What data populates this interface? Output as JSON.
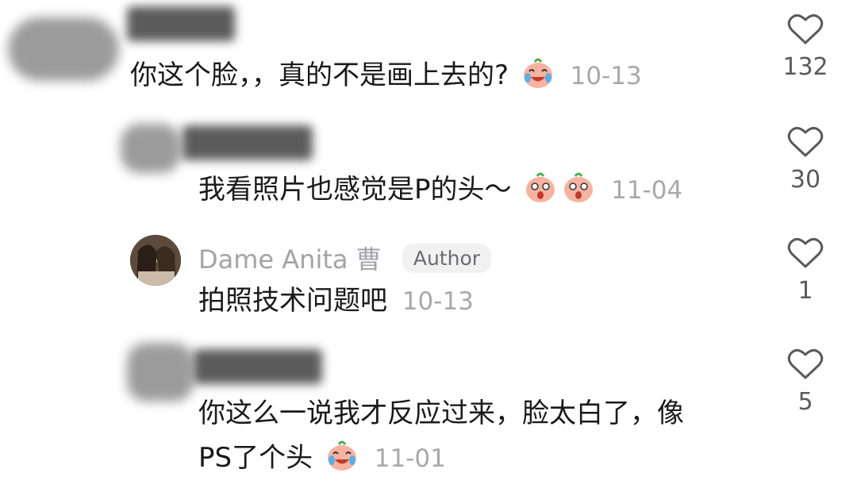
{
  "comments": [
    {
      "text": "你这个脸，，真的不是画上去的?",
      "emoji": "laugh-cry-emoji",
      "timestamp": "10-13",
      "likes": "132"
    },
    {
      "text": "我看照片也感觉是P的头～",
      "emoji": "shocked-emoji",
      "timestamp": "11-04",
      "likes": "30"
    },
    {
      "author": "Dame Anita 曹",
      "badge": "Author",
      "text": "拍照技术问题吧",
      "timestamp": "10-13",
      "likes": "1"
    },
    {
      "line1": "你这么一说我才反应过来，脸太白了，像",
      "line2": "PS了个头",
      "emoji": "laugh-cry-emoji",
      "timestamp": "11-01",
      "likes": "5"
    }
  ]
}
